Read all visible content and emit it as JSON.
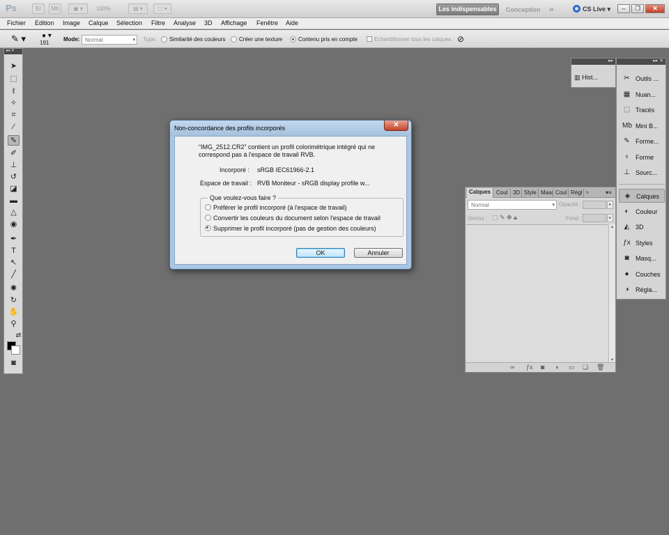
{
  "app": {
    "logo": "Ps",
    "zoom": "100%",
    "workspace_active": "Les indispensables",
    "workspace_other": "Conception",
    "workspace_more": "»",
    "cs_live": "CS Live",
    "window_buttons": [
      "–",
      "❐",
      "✕"
    ]
  },
  "menu": [
    "Fichier",
    "Edition",
    "Image",
    "Calque",
    "Sélection",
    "Filtre",
    "Analyse",
    "3D",
    "Affichage",
    "Fenêtre",
    "Aide"
  ],
  "options_bar": {
    "brush_size": "191",
    "mode_label": "Mode:",
    "mode_value": "Normal",
    "type_label": "Type:",
    "type_option_1": "Similarité des couleurs",
    "type_option_2": "Créer une texture",
    "type_option_3": "Contenu pris en compte",
    "sample_all": "Echantillonner tous les calques"
  },
  "history_panel": {
    "label": "Hist..."
  },
  "dock": {
    "group1": [
      "Outils ...",
      "Nuan...",
      "Tracés",
      "Mini B...",
      "Forme...",
      "Forme",
      "Sourc..."
    ],
    "group2": [
      "Calques",
      "Couleur",
      "3D",
      "Styles",
      "Masq...",
      "Couches",
      "Régla..."
    ]
  },
  "layers_panel": {
    "tabs": [
      "Calques",
      "Coul",
      "3D",
      "Style",
      "Masq",
      "Coul",
      "Régl"
    ],
    "blend_mode": "Normal",
    "opacity_label": "Opacité :",
    "lock_label": "Verrou :",
    "fill_label": "Fond :"
  },
  "dialog": {
    "title": "Non-concordance des profils incorporés",
    "close": "✕",
    "message": "“IMG_2512.CR2” contient un profil colorimétrique intégré qui ne correspond pas à l'espace de travail RVB.",
    "embedded_label": "Incorporé :",
    "embedded_value": "sRGB IEC61966-2.1",
    "working_label": "Espace de travail :",
    "working_value": "RVB Moniteur - sRGB display profile w...",
    "question": "Que voulez-vous faire ?",
    "options": [
      "Préférer le profil incorporé (à l'espace de travail)",
      "Convertir les couleurs du document selon l'espace de travail",
      "Supprimer le profil incorporé (pas de gestion des couleurs)"
    ],
    "selected_option": 2,
    "ok": "OK",
    "cancel": "Annuler"
  }
}
